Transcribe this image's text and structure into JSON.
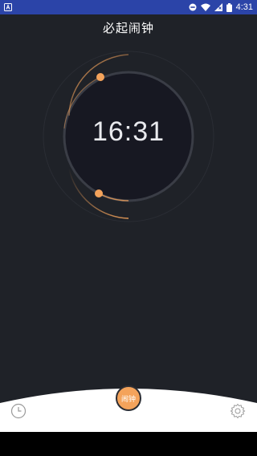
{
  "status_bar": {
    "time": "4:31",
    "icons": [
      "notification-a-icon",
      "dnd-icon",
      "wifi-icon",
      "no-sim-icon",
      "battery-icon"
    ]
  },
  "header": {
    "title": "必起闹钟"
  },
  "clock": {
    "time": "16:31"
  },
  "bottom": {
    "alarm_label": "闹钟",
    "left_icon": "clock-icon",
    "right_icon": "gear-icon"
  },
  "colors": {
    "background": "#1f2228",
    "status_bar": "#2b44a8",
    "accent": "#f4a35b",
    "dial_face": "#171822",
    "bottom_panel": "#ffffff"
  }
}
